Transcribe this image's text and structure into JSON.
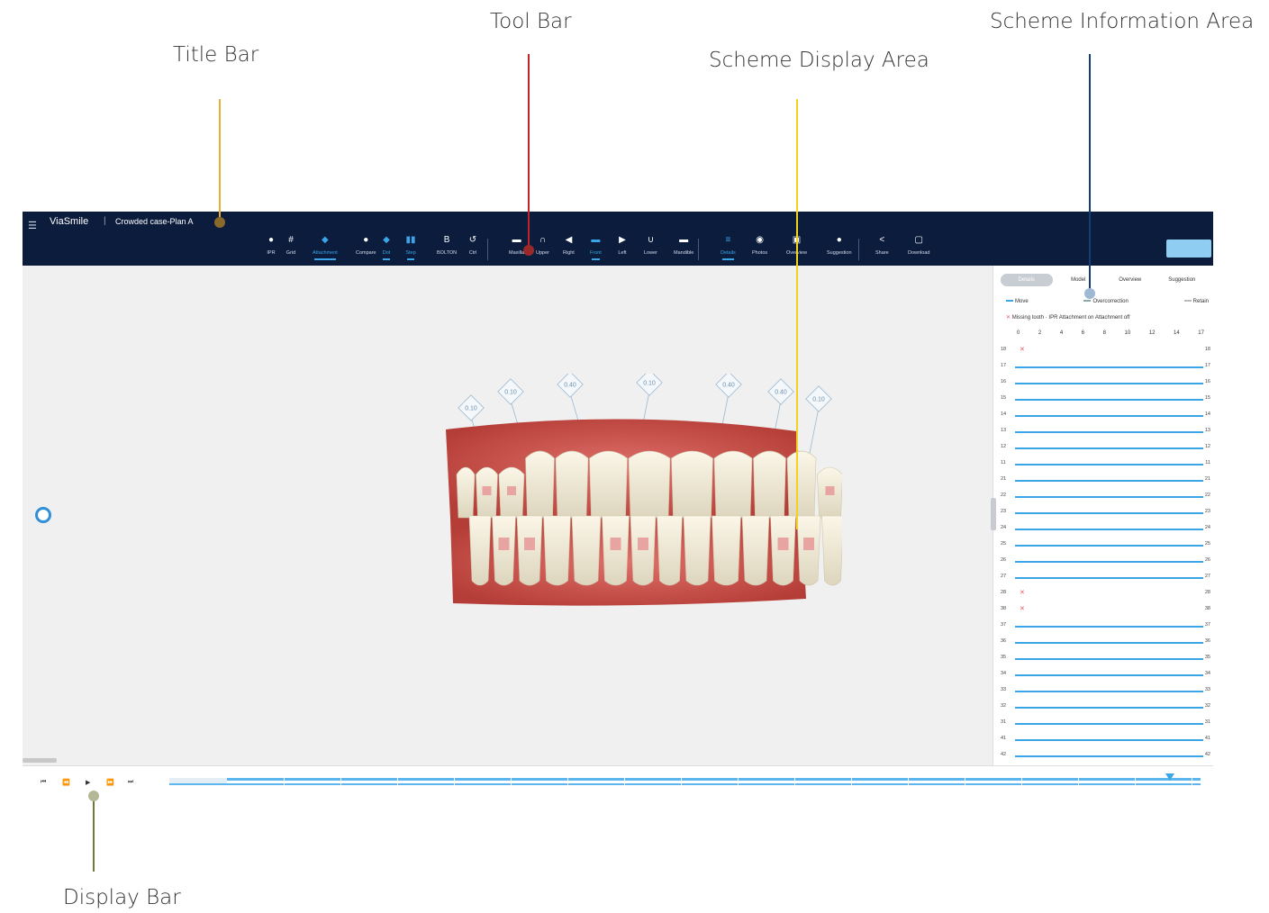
{
  "callouts": {
    "title_bar": "Title Bar",
    "tool_bar": "Tool Bar",
    "scheme_display_area": "Scheme Display Area",
    "scheme_information_area": "Scheme Information Area",
    "display_bar": "Display Bar"
  },
  "colors": {
    "title_bar_line": "#e8b03a",
    "tool_bar_line": "#c0242a",
    "scheme_display_line": "#f2d21a",
    "scheme_info_line": "#123e78",
    "display_bar_line": "#6e7a3a",
    "accent": "#3aa6e8",
    "titlebar_bg": "#0b1c3d"
  },
  "titlebar": {
    "logo": "ViaSmile",
    "separator": "|",
    "case_name": "Crowded case-Plan A"
  },
  "toolbar": {
    "tools": [
      {
        "label": "IPR",
        "icon": "tooth-icon"
      },
      {
        "label": "Grid",
        "icon": "grid-icon"
      },
      {
        "label": "Attachment",
        "icon": "attachment-icon",
        "active": true
      },
      {
        "label": "Compare",
        "icon": "compare-icon"
      },
      {
        "label": "Dot",
        "icon": "dot-icon",
        "active": true
      },
      {
        "label": "Step",
        "icon": "step-icon",
        "active": true
      },
      {
        "label": "BOLTON",
        "icon": "bolton-icon"
      },
      {
        "label": "Ctrl",
        "icon": "undo-icon"
      },
      {
        "label": "Maxilla",
        "icon": "maxilla-icon"
      },
      {
        "label": "Upper",
        "icon": "upper-icon"
      },
      {
        "label": "Right",
        "icon": "right-view-icon"
      },
      {
        "label": "Front",
        "icon": "front-view-icon",
        "active": true
      },
      {
        "label": "Left",
        "icon": "left-view-icon"
      },
      {
        "label": "Lower",
        "icon": "lower-icon"
      },
      {
        "label": "Mandible",
        "icon": "mandible-icon"
      },
      {
        "label": "Details",
        "icon": "details-icon",
        "active": true
      },
      {
        "label": "Photos",
        "icon": "camera-icon"
      },
      {
        "label": "Overview",
        "icon": "overview-icon"
      },
      {
        "label": "Suggestion",
        "icon": "suggestion-icon"
      },
      {
        "label": "Share",
        "icon": "share-icon"
      },
      {
        "label": "Download",
        "icon": "download-icon"
      }
    ]
  },
  "scheme_display": {
    "ipr_labels": [
      "0.10",
      "0.10",
      "0.40",
      "0.10",
      "0.40",
      "0.40",
      "0.10"
    ]
  },
  "panel": {
    "tabs": [
      "Details",
      "Model",
      "Overview",
      "Suggestion"
    ],
    "legend": {
      "move": "Move",
      "overcorrection": "Overcorrection",
      "retain": "Retain"
    },
    "legend2": {
      "missing": "Missing tooth",
      "ipr": "IPR",
      "attach_on": "Attachment on",
      "attach_off": "Attachment off"
    },
    "scale": [
      "0",
      "2",
      "4",
      "6",
      "8",
      "10",
      "12",
      "14",
      "17"
    ],
    "teeth": [
      {
        "id": "18",
        "state": "missing"
      },
      {
        "id": "17",
        "state": "move"
      },
      {
        "id": "16",
        "state": "move"
      },
      {
        "id": "15",
        "state": "move"
      },
      {
        "id": "14",
        "state": "move"
      },
      {
        "id": "13",
        "state": "move"
      },
      {
        "id": "12",
        "state": "move"
      },
      {
        "id": "11",
        "state": "move"
      },
      {
        "id": "21",
        "state": "move"
      },
      {
        "id": "22",
        "state": "move"
      },
      {
        "id": "23",
        "state": "move"
      },
      {
        "id": "24",
        "state": "move"
      },
      {
        "id": "25",
        "state": "move"
      },
      {
        "id": "26",
        "state": "move"
      },
      {
        "id": "27",
        "state": "move"
      },
      {
        "id": "28",
        "state": "missing"
      },
      {
        "id": "38",
        "state": "missing"
      },
      {
        "id": "37",
        "state": "move"
      },
      {
        "id": "36",
        "state": "move"
      },
      {
        "id": "35",
        "state": "move"
      },
      {
        "id": "34",
        "state": "move"
      },
      {
        "id": "33",
        "state": "move"
      },
      {
        "id": "32",
        "state": "move"
      },
      {
        "id": "31",
        "state": "move"
      },
      {
        "id": "41",
        "state": "move"
      },
      {
        "id": "42",
        "state": "move"
      }
    ]
  },
  "displaybar": {
    "buttons": [
      {
        "name": "first-step-button",
        "glyph": "⏮"
      },
      {
        "name": "prev-step-button",
        "glyph": "⏪"
      },
      {
        "name": "play-button",
        "glyph": "▶"
      },
      {
        "name": "next-step-button",
        "glyph": "⏩"
      },
      {
        "name": "last-step-button",
        "glyph": "⏭"
      }
    ],
    "progress_fraction": 0.97
  }
}
